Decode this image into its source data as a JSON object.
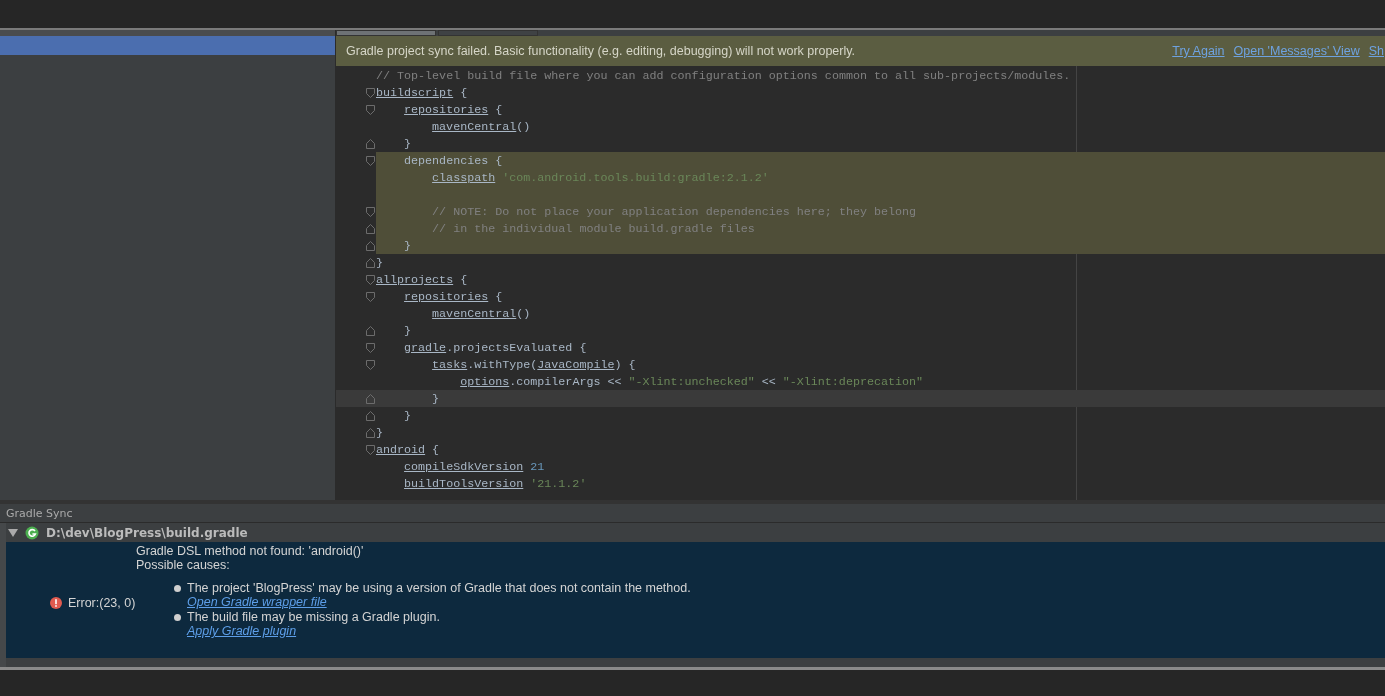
{
  "project_panel": {
    "items": [
      {
        "selected": true
      }
    ]
  },
  "editor_tabs": [
    {
      "selected": true
    },
    {
      "selected": false
    }
  ],
  "notification": {
    "message": "Gradle project sync failed. Basic functionality (e.g. editing, debugging) will not work properly.",
    "links": [
      "Try Again",
      "Open 'Messages' View",
      "Sh"
    ]
  },
  "code_lines": [
    {
      "highlighted": false,
      "current": false,
      "segments": [
        {
          "kind": "comment",
          "text": "// Top-level build file where you can add configuration options common to all sub-projects/modules."
        }
      ]
    },
    {
      "kind": "block_start",
      "highlighted": false,
      "current": false,
      "segments": [
        {
          "kind": "ref",
          "text": "buildscript"
        },
        {
          "kind": "text",
          "text": "{",
          "space_before": true
        }
      ],
      "children": [
        {
          "kind": "block_start",
          "highlighted": false,
          "current": false,
          "segments": [
            {
              "kind": "ref",
              "text": "repositories"
            },
            {
              "kind": "text",
              "text": "{",
              "space_before": true
            }
          ],
          "children": [
            {
              "highlighted": false,
              "current": false,
              "segments": [
                {
                  "kind": "ref",
                  "text": "mavenCentral"
                },
                {
                  "kind": "text",
                  "text": "()"
                }
              ]
            }
          ]
        },
        {
          "kind": "block_end",
          "highlighted": false,
          "current": false,
          "segments": [
            {
              "kind": "text",
              "text": "}"
            }
          ]
        },
        {
          "kind": "block_start",
          "highlighted": true,
          "current": false,
          "segments": [
            {
              "kind": "text",
              "text": "dependencies {"
            }
          ],
          "children": [
            {
              "highlighted": true,
              "current": false,
              "segments": [
                {
                  "kind": "ref",
                  "text": "classpath"
                },
                {
                  "kind": "string",
                  "text": "'com.android.tools.build:gradle:2.1.2'",
                  "space_before": true
                }
              ]
            },
            {
              "highlighted": true,
              "current": false
            },
            {
              "kind": "block_start",
              "highlighted": true,
              "current": false,
              "segments": [
                {
                  "kind": "comment",
                  "text": "// NOTE: Do not place your application dependencies here; they belong"
                }
              ]
            },
            {
              "kind": "block_end",
              "highlighted": true,
              "current": false,
              "segments": [
                {
                  "kind": "comment",
                  "text": "// in the individual module build.gradle files"
                }
              ]
            }
          ]
        },
        {
          "kind": "block_end",
          "highlighted": true,
          "current": false,
          "segments": [
            {
              "kind": "text",
              "text": "}"
            }
          ]
        }
      ]
    },
    {
      "kind": "block_end",
      "highlighted": false,
      "current": false,
      "segments": [
        {
          "kind": "text",
          "text": "}"
        }
      ]
    },
    {
      "kind": "block_start",
      "highlighted": false,
      "current": false,
      "segments": [
        {
          "kind": "ref",
          "text": "allprojects"
        },
        {
          "kind": "text",
          "text": "{",
          "space_before": true
        }
      ],
      "children": [
        {
          "kind": "block_start",
          "highlighted": false,
          "current": false,
          "segments": [
            {
              "kind": "ref",
              "text": "repositories"
            },
            {
              "kind": "text",
              "text": "{",
              "space_before": true
            }
          ],
          "children": [
            {
              "highlighted": false,
              "current": false,
              "segments": [
                {
                  "kind": "ref",
                  "text": "mavenCentral"
                },
                {
                  "kind": "text",
                  "text": "()"
                }
              ]
            }
          ]
        },
        {
          "kind": "block_end",
          "highlighted": false,
          "current": false,
          "segments": [
            {
              "kind": "text",
              "text": "}"
            }
          ]
        },
        {
          "kind": "block_start",
          "highlighted": false,
          "current": false,
          "segments": [
            {
              "kind": "ref",
              "text": "gradle"
            },
            {
              "kind": "text",
              "text": ".projectsEvaluated {"
            }
          ],
          "children": [
            {
              "kind": "block_start",
              "highlighted": false,
              "current": false,
              "segments": [
                {
                  "kind": "ref",
                  "text": "tasks"
                },
                {
                  "kind": "text",
                  "text": ".withType("
                },
                {
                  "kind": "ref",
                  "text": "JavaCompile"
                },
                {
                  "kind": "text",
                  "text": ") {"
                }
              ],
              "children": [
                {
                  "highlighted": false,
                  "current": false,
                  "segments": [
                    {
                      "kind": "ref",
                      "text": "options"
                    },
                    {
                      "kind": "text",
                      "text": ".compilerArgs <<"
                    },
                    {
                      "kind": "string",
                      "text": "\"-Xlint:unchecked\"",
                      "space_before": true
                    },
                    {
                      "kind": "text",
                      "text": "<<",
                      "space_before": true
                    },
                    {
                      "kind": "string",
                      "text": "\"-Xlint:deprecation\"",
                      "space_before": true
                    }
                  ]
                }
              ]
            },
            {
              "kind": "block_end",
              "highlighted": false,
              "current": true,
              "segments": [
                {
                  "kind": "text",
                  "text": "}"
                }
              ]
            }
          ]
        },
        {
          "kind": "block_end",
          "highlighted": false,
          "current": false,
          "segments": [
            {
              "kind": "text",
              "text": "}"
            }
          ]
        }
      ]
    },
    {
      "kind": "block_end",
      "highlighted": false,
      "current": false,
      "segments": [
        {
          "kind": "text",
          "text": "}"
        }
      ]
    },
    {
      "kind": "block_start",
      "highlighted": false,
      "current": false,
      "segments": [
        {
          "kind": "ref",
          "text": "android"
        },
        {
          "kind": "text",
          "text": "{",
          "space_before": true
        }
      ],
      "children": [
        {
          "highlighted": false,
          "current": false,
          "segments": [
            {
              "kind": "ref",
              "text": "compileSdkVersion"
            },
            {
              "kind": "number",
              "text": "21",
              "space_before": true
            }
          ]
        },
        {
          "highlighted": false,
          "current": false,
          "segments": [
            {
              "kind": "ref",
              "text": "buildToolsVersion"
            },
            {
              "kind": "string",
              "text": "'21.1.2'",
              "space_before": true
            }
          ]
        }
      ]
    }
  ],
  "messages_panel": {
    "title": "Gradle Sync",
    "tree": {
      "expanded": true,
      "path": "D:\\dev\\BlogPress\\build.gradle"
    },
    "error": {
      "location": "Error:(23, 0)",
      "lines": [
        "Gradle DSL method not found: 'android()'",
        "Possible causes:"
      ],
      "causes": [
        {
          "text": "The project 'BlogPress' may be using a version of Gradle that does not contain the method.",
          "link": "Open Gradle wrapper file"
        },
        {
          "text": "The build file may be missing a Gradle plugin.",
          "link": "Apply Gradle plugin"
        }
      ]
    }
  }
}
